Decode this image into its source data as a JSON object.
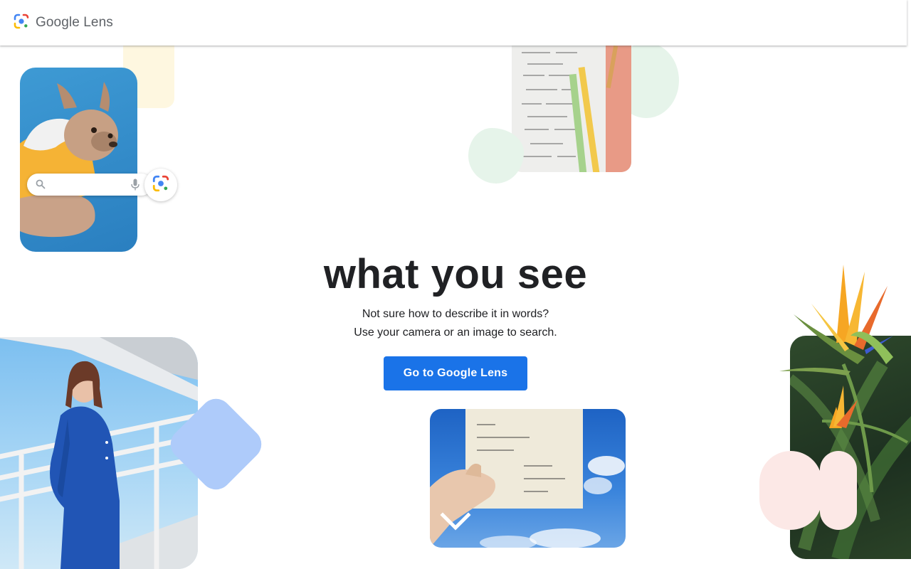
{
  "header": {
    "logo_google": "Google",
    "logo_product": "Lens"
  },
  "hero": {
    "headline": "what you see",
    "subtitle_line1": "Not sure how to describe it in words?",
    "subtitle_line2": "Use your camera or an image to search.",
    "cta_label": "Go to Google Lens"
  },
  "colors": {
    "accent_blue": "#1a73e8",
    "headline_text": "#202124",
    "logo_text": "#5f6368",
    "deco_yellow": "#fef7e0",
    "deco_green": "#e6f4ea",
    "deco_blue": "#aecbfa",
    "deco_pink": "#fce8e6"
  },
  "icons": {
    "logo": "google-lens-logo-icon",
    "search": "search-icon",
    "mic": "microphone-icon",
    "lens": "google-lens-icon",
    "scroll": "chevron-down-icon"
  }
}
